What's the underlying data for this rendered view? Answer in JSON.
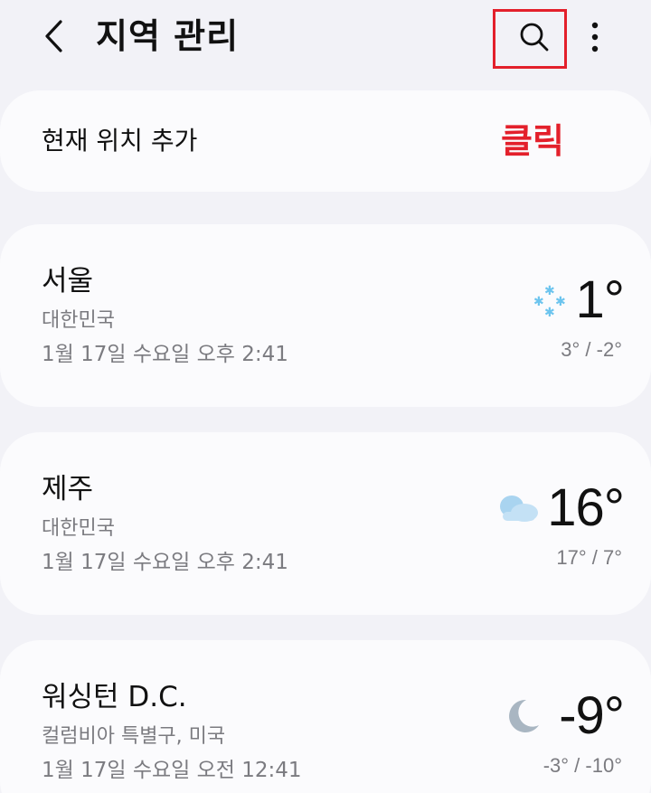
{
  "header": {
    "title": "지역 관리"
  },
  "current_location": {
    "label": "현재 위치 추가"
  },
  "annotation": {
    "text": "클릭",
    "color": "#e3202b"
  },
  "locations": [
    {
      "name": "서울",
      "country": "대한민국",
      "datetime": "1월 17일 수요일 오후 2:41",
      "temp": "1°",
      "range": "3° / -2°",
      "icon": "snow-icon"
    },
    {
      "name": "제주",
      "country": "대한민국",
      "datetime": "1월 17일 수요일 오후 2:41",
      "temp": "16°",
      "range": "17° / 7°",
      "icon": "cloud-icon"
    },
    {
      "name": "워싱턴 D.C.",
      "country": "컬럼비아 특별구, 미국",
      "datetime": "1월 17일 수요일 오전 12:41",
      "temp": "-9°",
      "range": "-3° / -10°",
      "icon": "moon-icon"
    }
  ]
}
